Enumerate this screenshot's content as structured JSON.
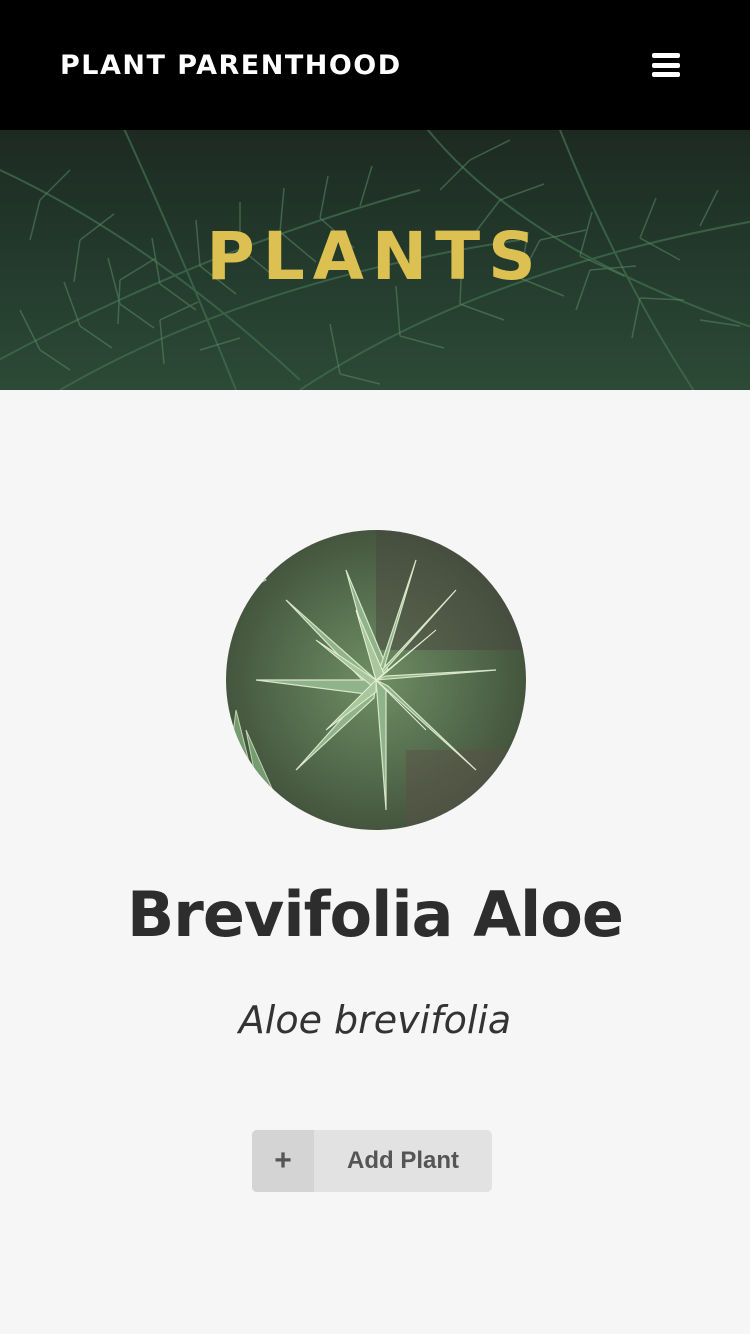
{
  "navbar": {
    "brand": "PLANT PARENTHOOD",
    "menu_icon": "hamburger-icon"
  },
  "hero": {
    "title": "PLANTS",
    "title_color": "#dcc152"
  },
  "plant": {
    "name": "Brevifolia Aloe",
    "scientific_name": "Aloe brevifolia",
    "photo_icon": "aloe-plant-photo"
  },
  "actions": {
    "add_icon": "plus-icon",
    "add_label": "Add Plant"
  }
}
